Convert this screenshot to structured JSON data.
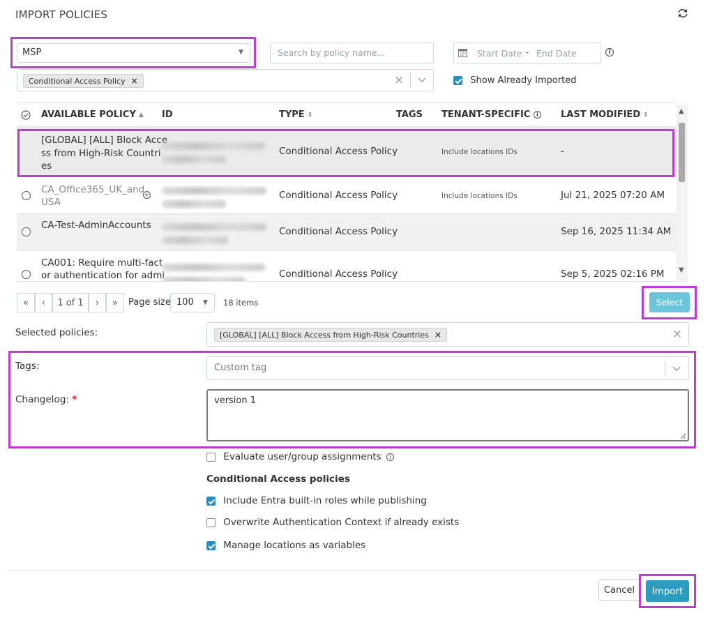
{
  "header": {
    "title": "IMPORT POLICIES",
    "refresh_icon": "refresh-icon"
  },
  "filters": {
    "tenant_select": {
      "value": "MSP"
    },
    "search": {
      "placeholder": "Search by policy name..."
    },
    "date_range": {
      "start_placeholder": "Start Date",
      "separator": "-",
      "end_placeholder": "End Date"
    },
    "type_filter_chip": "Conditional Access Policy",
    "show_already_imported": {
      "label": "Show Already Imported",
      "checked": true
    }
  },
  "table": {
    "columns": {
      "available_policy": "AVAILABLE POLICY",
      "id": "ID",
      "type": "TYPE",
      "tags": "TAGS",
      "tenant_specific": "TENANT-SPECIFIC",
      "last_modified": "LAST MODIFIED"
    },
    "rows": [
      {
        "name_lines": [
          "[GLOBAL] [ALL] Block Acce",
          "ss from High-Risk Countri",
          "es"
        ],
        "type": "Conditional Access Policy",
        "tenant_specific": "Include locations IDs",
        "last_modified": "-",
        "selected": true
      },
      {
        "name_lines": [
          "CA_Office365_UK_and_",
          "USA"
        ],
        "type": "Conditional Access Policy",
        "tenant_specific": "Include locations IDs",
        "last_modified": "Jul 21, 2025 07:20 AM",
        "selected": false,
        "dimmed": true
      },
      {
        "name_lines": [
          "CA-Test-AdminAccounts"
        ],
        "type": "Conditional Access Policy",
        "tenant_specific": "",
        "last_modified": "Sep 16, 2025 11:34 AM",
        "selected": false
      },
      {
        "name_lines": [
          "CA001: Require multi-fact",
          "or authentication for admi"
        ],
        "type": "Conditional Access Policy",
        "tenant_specific": "",
        "last_modified": "Sep 5, 2025 02:16 PM",
        "selected": false
      }
    ]
  },
  "pagination": {
    "first": "«",
    "prev": "‹",
    "page_text": "1 of 1",
    "next": "›",
    "last": "»",
    "page_size_label": "Page size",
    "page_size_value": "100",
    "items_count": "18 items",
    "select_button": "Select"
  },
  "form": {
    "selected_policies_label": "Selected policies:",
    "selected_policy_chip": "[GLOBAL] [ALL] Block Access from High-Risk Countries",
    "tags_label": "Tags:",
    "tags_placeholder": "Custom tag",
    "changelog_label": "Changelog:",
    "changelog_required_mark": "*",
    "changelog_value": "version 1",
    "evaluate_assignments": {
      "label": "Evaluate user/group assignments",
      "checked": false
    },
    "ca_section_title": "Conditional Access policies",
    "include_entra_roles": {
      "label": "Include Entra built-in roles while publishing",
      "checked": true
    },
    "overwrite_auth_context": {
      "label": "Overwrite Authentication Context if already exists",
      "checked": false
    },
    "manage_locations": {
      "label": "Manage locations as variables",
      "checked": true
    }
  },
  "footer": {
    "cancel_button": "Cancel",
    "import_button": "Import"
  },
  "colors": {
    "accent": "#2b9bbf",
    "select_button": "#6cc5da",
    "highlight": "#c13ad6"
  }
}
